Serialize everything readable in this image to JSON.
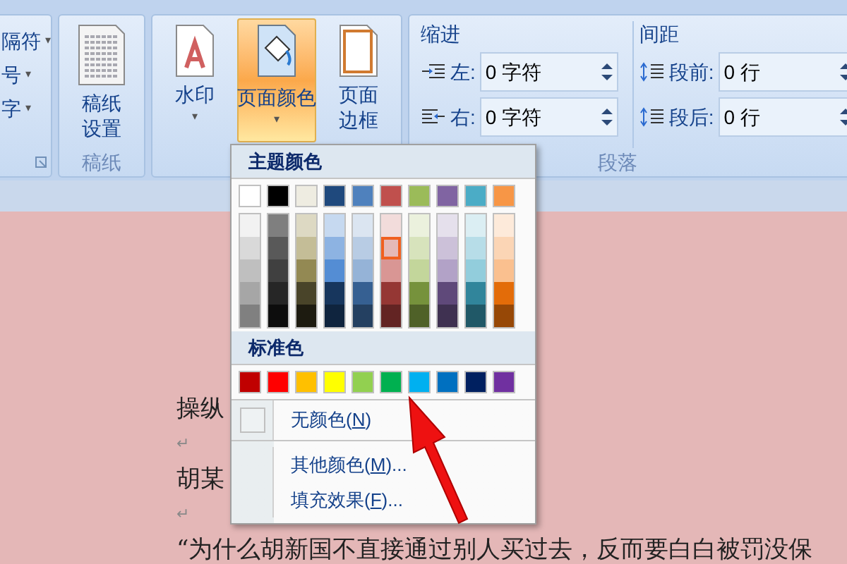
{
  "ribbon": {
    "groups": [
      {
        "kind": "partial",
        "items": [
          {
            "label": "隔符",
            "caret": "▾"
          },
          {
            "label": "号",
            "caret": "▾"
          },
          {
            "label": "字",
            "caret": "▾"
          }
        ]
      },
      {
        "kind": "buttons",
        "label": "稿纸",
        "buttons": [
          {
            "label": "稿纸设置",
            "selected": false
          }
        ]
      },
      {
        "kind": "buttons",
        "buttons": [
          {
            "label": "水印",
            "caret": "▾",
            "selected": false
          },
          {
            "label": "页面颜色",
            "caret": "▾",
            "selected": true
          },
          {
            "label": "页面边框",
            "selected": false
          }
        ]
      },
      {
        "kind": "paragraph",
        "label": "段落",
        "sections": [
          {
            "title": "缩进",
            "fields": [
              {
                "label": "左:",
                "value": "0 字符"
              },
              {
                "label": "右:",
                "value": "0 字符"
              }
            ]
          },
          {
            "title": "间距",
            "fields": [
              {
                "label": "段前:",
                "value": "0 行"
              },
              {
                "label": "段后:",
                "value": "0 行"
              }
            ]
          }
        ]
      }
    ]
  },
  "color_menu": {
    "theme_title": "主题颜色",
    "theme_colors": [
      {
        "color": "#ffffff",
        "shades": [
          {
            "color": "#f2f2f2",
            "selected": false
          },
          {
            "color": "#d9d9d9",
            "selected": false
          },
          {
            "color": "#bfbfbf",
            "selected": false
          },
          {
            "color": "#a6a6a6",
            "selected": false
          },
          {
            "color": "#808080",
            "selected": false
          }
        ]
      },
      {
        "color": "#000000",
        "shades": [
          {
            "color": "#7f7f7f",
            "selected": false
          },
          {
            "color": "#595959",
            "selected": false
          },
          {
            "color": "#404040",
            "selected": false
          },
          {
            "color": "#262626",
            "selected": false
          },
          {
            "color": "#0d0d0d",
            "selected": false
          }
        ]
      },
      {
        "color": "#eeece1",
        "shades": [
          {
            "color": "#ddd9c3",
            "selected": false
          },
          {
            "color": "#c4bd97",
            "selected": false
          },
          {
            "color": "#938953",
            "selected": false
          },
          {
            "color": "#494429",
            "selected": false
          },
          {
            "color": "#1d1b10",
            "selected": false
          }
        ]
      },
      {
        "color": "#1f497d",
        "shades": [
          {
            "color": "#c6d9f0",
            "selected": false
          },
          {
            "color": "#8db3e2",
            "selected": false
          },
          {
            "color": "#548dd4",
            "selected": false
          },
          {
            "color": "#17365d",
            "selected": false
          },
          {
            "color": "#0f243e",
            "selected": false
          }
        ]
      },
      {
        "color": "#4f81bd",
        "shades": [
          {
            "color": "#dbe5f1",
            "selected": false
          },
          {
            "color": "#b8cce4",
            "selected": false
          },
          {
            "color": "#95b3d7",
            "selected": false
          },
          {
            "color": "#366092",
            "selected": false
          },
          {
            "color": "#244061",
            "selected": false
          }
        ]
      },
      {
        "color": "#c0504d",
        "shades": [
          {
            "color": "#f2dcdb",
            "selected": false
          },
          {
            "color": "#e5b9b7",
            "selected": true
          },
          {
            "color": "#d99694",
            "selected": false
          },
          {
            "color": "#953734",
            "selected": false
          },
          {
            "color": "#632423",
            "selected": false
          }
        ]
      },
      {
        "color": "#9bbb59",
        "shades": [
          {
            "color": "#ebf1dd",
            "selected": false
          },
          {
            "color": "#d7e3bc",
            "selected": false
          },
          {
            "color": "#c3d69b",
            "selected": false
          },
          {
            "color": "#76923c",
            "selected": false
          },
          {
            "color": "#4f6128",
            "selected": false
          }
        ]
      },
      {
        "color": "#8064a2",
        "shades": [
          {
            "color": "#e5e0ec",
            "selected": false
          },
          {
            "color": "#ccc1d9",
            "selected": false
          },
          {
            "color": "#b2a2c7",
            "selected": false
          },
          {
            "color": "#5f497a",
            "selected": false
          },
          {
            "color": "#3f3151",
            "selected": false
          }
        ]
      },
      {
        "color": "#4bacc6",
        "shades": [
          {
            "color": "#dbeef3",
            "selected": false
          },
          {
            "color": "#b7dde8",
            "selected": false
          },
          {
            "color": "#92cddc",
            "selected": false
          },
          {
            "color": "#31859b",
            "selected": false
          },
          {
            "color": "#205867",
            "selected": false
          }
        ]
      },
      {
        "color": "#f79646",
        "shades": [
          {
            "color": "#fdeada",
            "selected": false
          },
          {
            "color": "#fbd5b5",
            "selected": false
          },
          {
            "color": "#fac08f",
            "selected": false
          },
          {
            "color": "#e36c09",
            "selected": false
          },
          {
            "color": "#974806",
            "selected": false
          }
        ]
      }
    ],
    "standard_title": "标准色",
    "standard_colors": [
      {
        "color": "#c00000"
      },
      {
        "color": "#ff0000"
      },
      {
        "color": "#ffc000"
      },
      {
        "color": "#ffff00"
      },
      {
        "color": "#92d050"
      },
      {
        "color": "#00b050"
      },
      {
        "color": "#00b0f0"
      },
      {
        "color": "#0070c0"
      },
      {
        "color": "#002060"
      },
      {
        "color": "#7030a0"
      }
    ],
    "items": [
      {
        "kind": "no-color",
        "before": "无颜色(",
        "key": "N",
        "after": ")"
      },
      {
        "kind": "plain",
        "before": "其他颜色(",
        "key": "M",
        "after": ")..."
      },
      {
        "kind": "plain",
        "before": "填充效果(",
        "key": "F",
        "after": ")..."
      }
    ]
  },
  "document": {
    "lines": [
      {
        "kind": "text",
        "text": "操纵"
      },
      {
        "kind": "mark",
        "text": "↵"
      },
      {
        "kind": "text",
        "text": "胡某"
      },
      {
        "kind": "mark",
        "text": "↵"
      },
      {
        "kind": "text",
        "text": "“为什么胡新国不直接通过别人买过去，反而要白白被罚没保"
      }
    ]
  }
}
